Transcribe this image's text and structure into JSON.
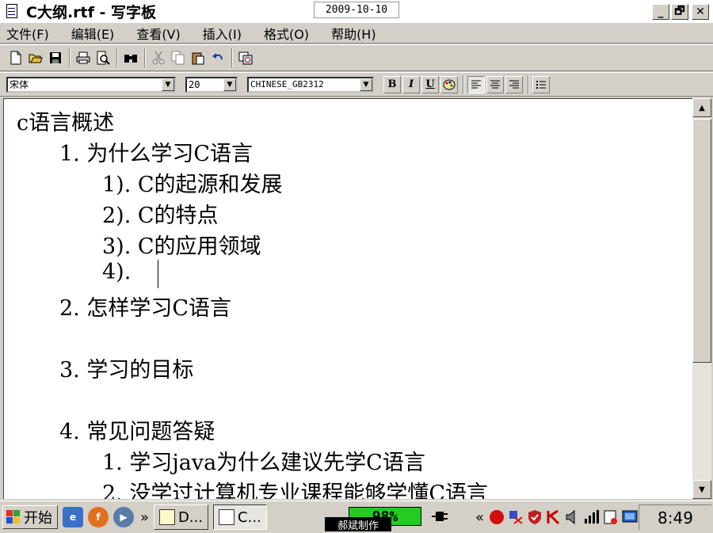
{
  "window": {
    "title": "C大纲.rtf - 写字板",
    "date_stamp": "2009-10-10",
    "minimize_label": "_",
    "restore_label": "🗗",
    "close_label": "✕"
  },
  "menu": [
    {
      "label": "文件(F)"
    },
    {
      "label": "编辑(E)"
    },
    {
      "label": "查看(V)"
    },
    {
      "label": "插入(I)"
    },
    {
      "label": "格式(O)"
    },
    {
      "label": "帮助(H)"
    }
  ],
  "format_bar": {
    "font": "宋体",
    "size": "20",
    "script": "CHINESE_GB2312",
    "bold": "B",
    "italic": "I",
    "underline": "U"
  },
  "document": {
    "lines": [
      "c语言概述",
      "1.  为什么学习C语言",
      "1).  C的起源和发展",
      "2).  C的特点",
      "3).  C的应用领域",
      "4).",
      "2.  怎样学习C语言",
      "3.  学习的目标",
      "4.  常见问题答疑",
      "1.  学习java为什么建议先学C语言",
      "2.  没学过计算机专业课程能够学懂C语言"
    ]
  },
  "taskbar": {
    "start_label": "开始",
    "more_label": "»",
    "tasks": [
      {
        "label": "D..."
      },
      {
        "label": "C..."
      }
    ],
    "battery": "98%",
    "maker_label": "郝斌制作",
    "tray_more": "«",
    "clock": "8:49"
  },
  "colors": {
    "titlebar_bg": "#ffffff",
    "window_chrome": "#d4d0c8",
    "battery_green": "#22cc22"
  }
}
